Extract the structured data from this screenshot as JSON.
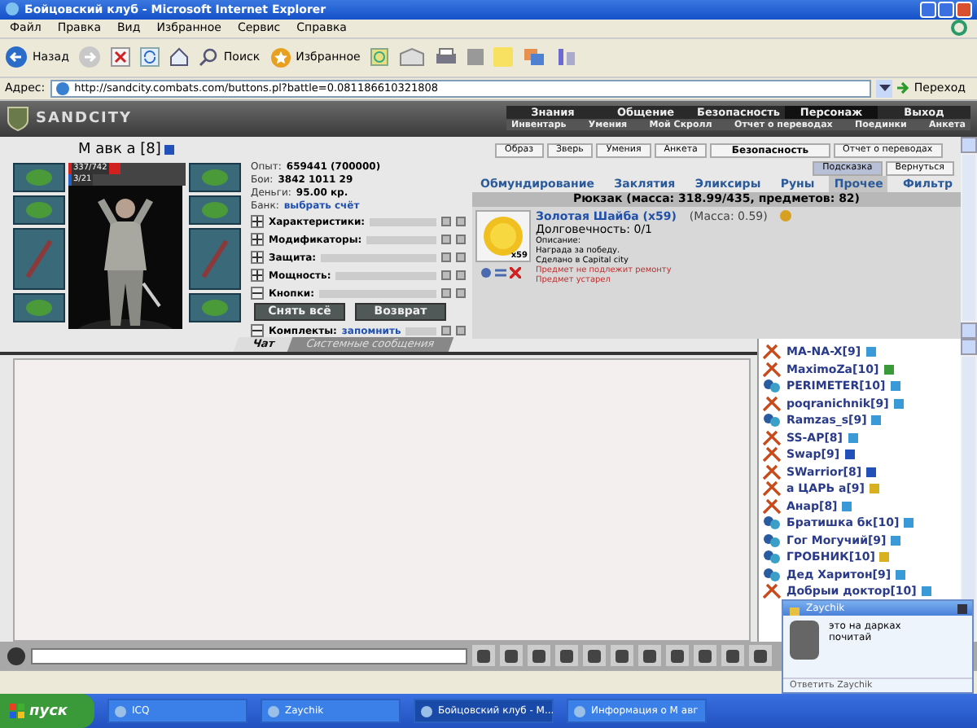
{
  "window": {
    "title": "Бойцовский клуб - Microsoft Internet Explorer"
  },
  "menu": [
    "Файл",
    "Правка",
    "Вид",
    "Избранное",
    "Сервис",
    "Справка"
  ],
  "toolbar": {
    "back": "Назад",
    "search": "Поиск",
    "favorites": "Избранное"
  },
  "address": {
    "label": "Адрес:",
    "value": "http://sandcity.combats.com/buttons.pl?battle=0.081186610321808",
    "go": "Переход"
  },
  "game": {
    "logo": "SANDCITY",
    "nav": [
      {
        "label": "Знания",
        "selected": false
      },
      {
        "label": "Общение",
        "selected": false
      },
      {
        "label": "Безопасность",
        "selected": false
      },
      {
        "label": "Персонаж",
        "selected": true
      },
      {
        "label": "Выход",
        "selected": false
      }
    ],
    "subnav": [
      "Инвентарь",
      "Умения",
      "Мой Скролл",
      "Отчет о переводах",
      "Поединки",
      "Анкета"
    ]
  },
  "character": {
    "name": "М авк а [8]",
    "hp": "337/742",
    "hp_bar": {
      "level": 0.45
    },
    "mana": "3/21",
    "mana_bar": {
      "level": 0.14
    },
    "stats": [
      {
        "label": "Опыт:",
        "value": "659441 (700000)"
      },
      {
        "label": "Бои:",
        "value": "3842  1011  29"
      },
      {
        "label": "Деньги:",
        "value": "95.00 кр."
      }
    ],
    "bank": {
      "label": "Банк:",
      "link": "выбрать счёт"
    },
    "sections": [
      {
        "label": "Характеристики:",
        "expanded": false
      },
      {
        "label": "Модификаторы:",
        "expanded": false
      },
      {
        "label": "Защита:",
        "expanded": false
      },
      {
        "label": "Мощность:",
        "expanded": false
      },
      {
        "label": "Кнопки:",
        "expanded": true,
        "buttons": [
          "Снять всё",
          "Возврат"
        ]
      },
      {
        "label": "Комплекты:",
        "expanded": true,
        "link": "запомнить"
      }
    ]
  },
  "inventory": {
    "top_buttons": [
      {
        "label": "Образ",
        "bold": false
      },
      {
        "label": "Зверь",
        "bold": false
      },
      {
        "label": "Умения",
        "bold": false
      },
      {
        "label": "Анкета",
        "bold": false
      },
      {
        "label": "Безопасность",
        "bold": true
      },
      {
        "label": "Отчет о переводах",
        "bold": false
      }
    ],
    "hint_buttons": [
      {
        "label": "Подсказка",
        "selected": true
      },
      {
        "label": "Вернуться",
        "selected": false
      }
    ],
    "categories": [
      {
        "label": "Обмундирование",
        "selected": false
      },
      {
        "label": "Заклятия",
        "selected": false
      },
      {
        "label": "Эликсиры",
        "selected": false
      },
      {
        "label": "Руны",
        "selected": false
      },
      {
        "label": "Прочее",
        "selected": true
      },
      {
        "label": "Фильтр",
        "selected": false
      }
    ],
    "header": "Рюкзак (масса: 318.99/435, предметов: 82)",
    "item": {
      "count": "x59",
      "name": "Золотая Шайба (x59)",
      "mass": "(Масса: 0.59)",
      "durability": "Долговечность: 0/1",
      "lines": [
        {
          "text": "Описание:",
          "kind": "plain"
        },
        {
          "text": "Награда за победу.",
          "kind": "plain"
        },
        {
          "text": "Сделано в Capital city",
          "kind": "plain"
        },
        {
          "text": "Предмет не подлежит ремонту",
          "kind": "warning"
        },
        {
          "text": "Предмет устарел",
          "kind": "warning"
        }
      ]
    }
  },
  "chat_tabs": [
    {
      "label": "Чат",
      "selected": true
    },
    {
      "label": "Системные сообщения",
      "selected": false
    }
  ],
  "users": [
    {
      "name": "MA-NA-X[9]",
      "kind": "a",
      "color": "#3a9ad8"
    },
    {
      "name": "MaximoZa[10]",
      "kind": "a",
      "color": "#3a9a3a"
    },
    {
      "name": "PERIMETER[10]",
      "kind": "b",
      "color": "#3a9ad8"
    },
    {
      "name": "poqranichnik[9]",
      "kind": "a",
      "color": "#3a9ad8"
    },
    {
      "name": "Ramzas_s[9]",
      "kind": "b",
      "color": "#3a9ad8"
    },
    {
      "name": "SS-AP[8]",
      "kind": "a",
      "color": "#3a9ad8"
    },
    {
      "name": "Swap[9]",
      "kind": "a",
      "color": "#2050b8"
    },
    {
      "name": "SWarrior[8]",
      "kind": "a",
      "color": "#2050b8"
    },
    {
      "name": "а ЦАРЬ а[9]",
      "kind": "a",
      "color": "#d8b020"
    },
    {
      "name": "Анар[8]",
      "kind": "a",
      "color": "#3a9ad8"
    },
    {
      "name": "Братишка бк[10]",
      "kind": "b",
      "color": "#3a9ad8"
    },
    {
      "name": "Гог Могучий[9]",
      "kind": "b",
      "color": "#3a9ad8"
    },
    {
      "name": "ГРОБНИК[10]",
      "kind": "b",
      "color": "#d8b020"
    },
    {
      "name": "Дед Харитон[9]",
      "kind": "b",
      "color": "#3a9ad8"
    },
    {
      "name": "Добрыи доктор[10]",
      "kind": "a",
      "color": "#3a9ad8"
    }
  ],
  "popup": {
    "title": "Zaychik",
    "message": "это на дарках почитай",
    "reply": "Ответить Zaychik"
  },
  "taskbar": {
    "start": "пуск",
    "tasks": [
      {
        "label": "ICQ",
        "selected": false
      },
      {
        "label": "Zaychik",
        "selected": false
      },
      {
        "label": "Бойцовский клуб - M...",
        "selected": true
      },
      {
        "label": "Информация о М авг",
        "selected": false
      }
    ]
  }
}
